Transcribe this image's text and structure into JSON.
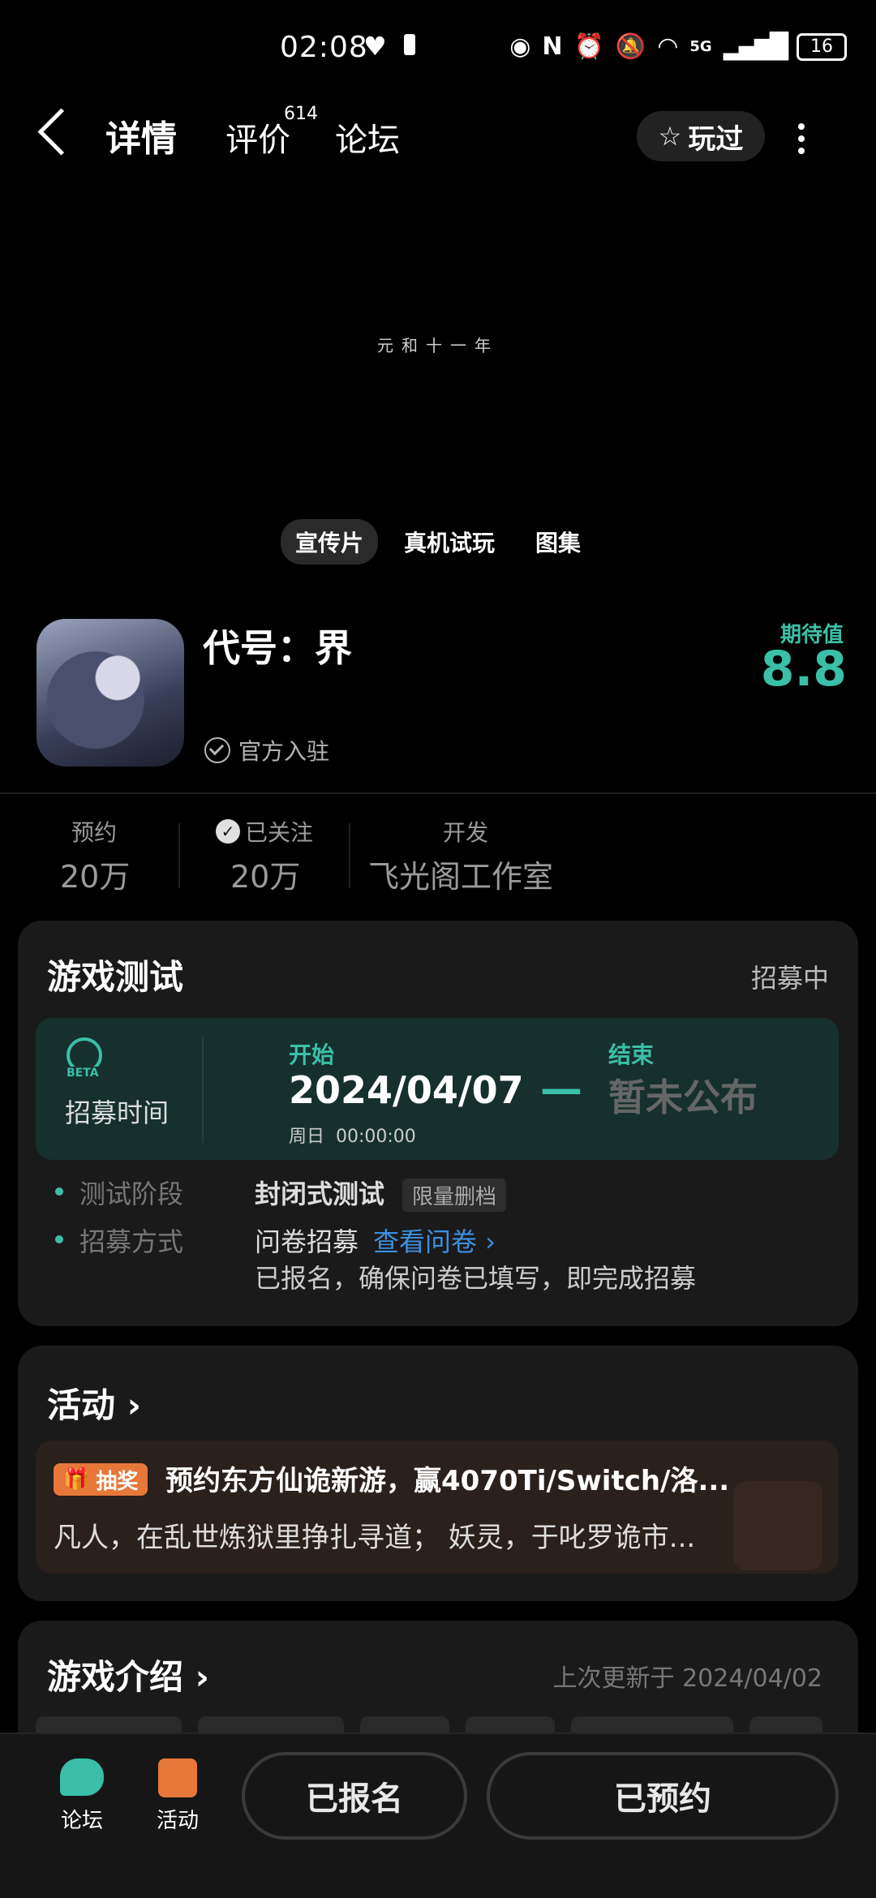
{
  "status_bar": {
    "time": "02:08",
    "network": "5G",
    "battery": "16"
  },
  "nav": {
    "tab_detail": "详情",
    "tab_review": "评价",
    "review_count": "614",
    "tab_forum": "论坛",
    "played_label": "玩过"
  },
  "video": {
    "caption": "元和十一年",
    "tabs": [
      "宣传片",
      "真机试玩",
      "图集"
    ],
    "active_tab": 0
  },
  "game": {
    "title": "代号：界",
    "official": "官方入驻",
    "expect_label": "期待值",
    "expect_value": "8.8"
  },
  "stats": [
    {
      "label": "预约",
      "value": "20万"
    },
    {
      "label": "已关注",
      "value": "20万"
    },
    {
      "label": "开发",
      "value": "飞光阁工作室"
    }
  ],
  "test_card": {
    "title": "游戏测试",
    "status": "招募中",
    "recruit_label": "招募时间",
    "beta_badge": "BETA",
    "start_label": "开始",
    "start_date": "2024/04/07",
    "start_sub": "周日  00:00:00",
    "end_label": "结束",
    "end_value": "暂未公布",
    "rows": [
      {
        "label": "测试阶段",
        "value": "封闭式测试",
        "tag": "限量删档"
      },
      {
        "label": "招募方式",
        "value": "问卷招募",
        "link": "查看问卷",
        "note": "已报名，确保问卷已填写，即完成招募"
      }
    ]
  },
  "activity_card": {
    "title": "活动",
    "badge": "抽奖",
    "headline": "预约东方仙诡新游，赢4070Ti/Switch/洛...",
    "desc": "凡人，在乱世炼狱里挣扎寻道； 妖灵，于叱罗诡市..."
  },
  "intro_card": {
    "title": "游戏介绍",
    "updated": "上次更新于 2024/04/02"
  },
  "bottom_bar": {
    "forum_label": "论坛",
    "activity_label": "活动",
    "registered_label": "已报名",
    "reserved_label": "已预约"
  },
  "colors": {
    "accent": "#3bbfa8",
    "background": "#000000",
    "card": "#1a1a1a",
    "link": "#3d8fe0",
    "prize_orange": "#e8773a"
  }
}
